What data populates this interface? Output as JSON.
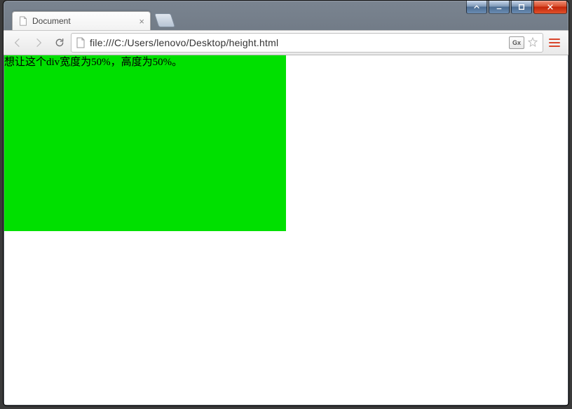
{
  "window": {
    "caption_buttons": {
      "extra_label": "extra",
      "minimize_label": "minimize",
      "maximize_label": "maximize",
      "close_label": "close"
    }
  },
  "tabs": [
    {
      "title": "Document"
    }
  ],
  "toolbar": {
    "back_label": "back",
    "forward_label": "forward",
    "reload_label": "reload",
    "menu_label": "menu",
    "translate_badge": "Gx",
    "star_label": "bookmark"
  },
  "omnibox": {
    "url": "file:///C:/Users/lenovo/Desktop/height.html"
  },
  "page": {
    "green_text": "想让这个div宽度为50%，高度为50%。"
  }
}
